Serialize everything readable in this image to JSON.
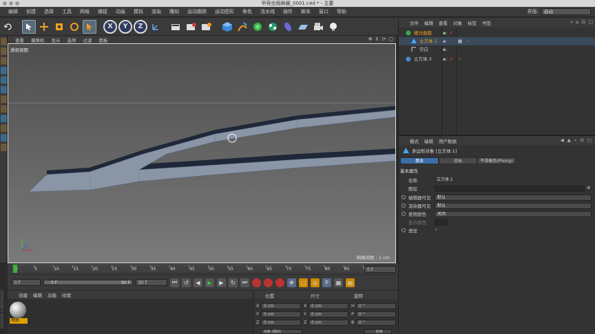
{
  "window": {
    "title": "甲壳虫雨刷器_0001.c4d * - 主要"
  },
  "menubar": {
    "items": [
      "编辑",
      "创建",
      "选择",
      "工具",
      "网格",
      "捕捉",
      "动画",
      "模拟",
      "渲染",
      "雕刻",
      "运动跟踪",
      "运动图形",
      "角色",
      "流水线",
      "插件",
      "脚本",
      "窗口",
      "帮助"
    ],
    "layout_label": "界面:",
    "layout_value": "启动"
  },
  "toolbar": {
    "icons": [
      "undo-icon",
      "select-icon",
      "move-icon",
      "scale-icon",
      "rotate-icon",
      "live-select-icon",
      "x-axis",
      "y-axis",
      "z-axis",
      "coordinate-icon",
      "render-view-icon",
      "render-picture-icon",
      "render-settings-icon",
      "cube-icon",
      "pen-icon",
      "subdivide-icon",
      "array-icon",
      "deformer-icon",
      "floor-icon",
      "camera-icon",
      "light-icon"
    ],
    "axis_x": "X",
    "axis_y": "Y",
    "axis_z": "Z"
  },
  "viewport": {
    "menu": [
      "查看",
      "摄像机",
      "显示",
      "选项",
      "过滤",
      "面板"
    ],
    "label": "透视视图",
    "grid_info": "网格间距 : 1 cm",
    "colors": {
      "bg": "#6a6a6a",
      "mesh": "#8a96a6",
      "edge": "#1f2838"
    }
  },
  "timeline": {
    "ticks": [
      "0",
      "5",
      "10",
      "15",
      "20",
      "25",
      "30",
      "35",
      "40",
      "45",
      "50",
      "55",
      "60",
      "65",
      "70",
      "75",
      "80",
      "85",
      "90"
    ],
    "frame_end": "0 F"
  },
  "transport": {
    "current_frame": "0 F",
    "range_start": "0 F",
    "range_end": "90 F",
    "max_frame": "90 F"
  },
  "material_manager": {
    "menu": [
      "创建",
      "编辑",
      "功能",
      "纹理"
    ],
    "material_name": "材质"
  },
  "coordinates": {
    "headers": [
      "位置",
      "尺寸",
      "旋转"
    ],
    "rows": [
      {
        "axis": "X",
        "pos": "0 cm",
        "size_axis": "X",
        "size": "0 cm",
        "rot_axis": "H",
        "rot": "0 °"
      },
      {
        "axis": "Y",
        "pos": "0 cm",
        "size_axis": "Y",
        "size": "0 cm",
        "rot_axis": "P",
        "rot": "0 °"
      },
      {
        "axis": "Z",
        "pos": "0 cm",
        "size_axis": "Z",
        "size": "0 cm",
        "rot_axis": "B",
        "rot": "0 °"
      }
    ],
    "mode_select": "对象 (相对)",
    "apply_label": "应用"
  },
  "object_manager": {
    "menu": [
      "文件",
      "编辑",
      "查看",
      "对象",
      "标签",
      "书签"
    ],
    "objects": [
      {
        "name": "细分曲面",
        "indent": 0,
        "selected": false
      },
      {
        "name": "立方体.1",
        "indent": 1,
        "selected": true
      },
      {
        "name": "空白",
        "indent": 1,
        "selected": false
      },
      {
        "name": "立方体.3",
        "indent": 0,
        "selected": false
      }
    ]
  },
  "attribute_manager": {
    "menu": [
      "模式",
      "编辑",
      "用户数据"
    ],
    "title": "多边形对象 [立方体.1]",
    "tabs": [
      "基本",
      "坐标",
      "平滑着色(Phong)"
    ],
    "section": "基本属性",
    "fields": [
      {
        "label": "名称",
        "value": "立方体.1"
      },
      {
        "label": "图层",
        "value": ""
      },
      {
        "label": "编辑器可见",
        "value": "默认"
      },
      {
        "label": "渲染器可见",
        "value": "默认"
      },
      {
        "label": "使用颜色",
        "value": "关闭"
      },
      {
        "label": "显示颜色",
        "value": ""
      },
      {
        "label": "透显",
        "value": ""
      }
    ]
  }
}
